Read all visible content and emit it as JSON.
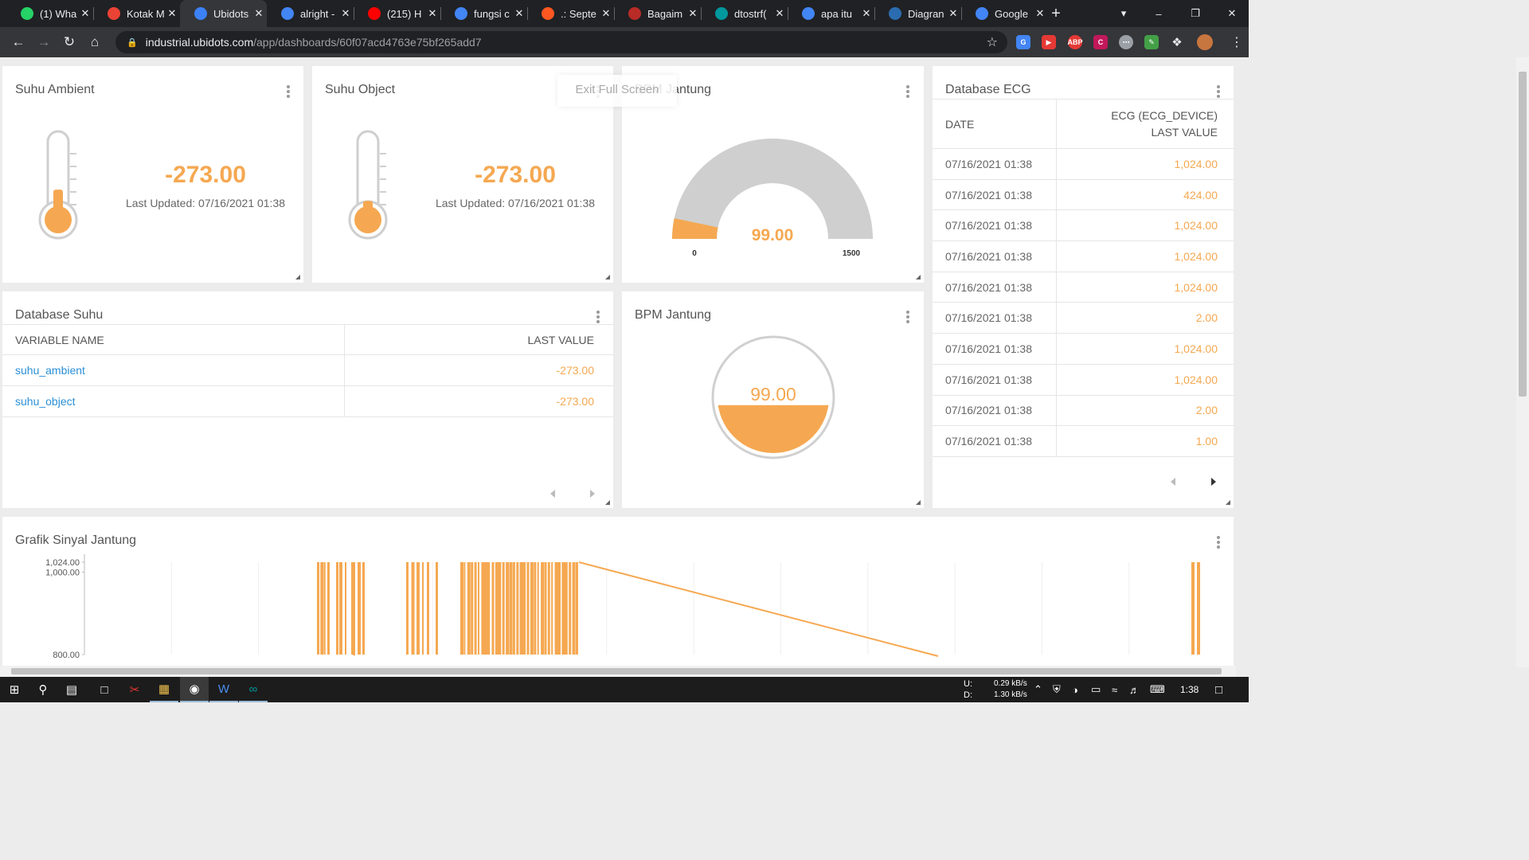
{
  "browser": {
    "tabs": [
      {
        "title": "(1) Wha",
        "icon": "whatsapp-icon",
        "color": "#25d366"
      },
      {
        "title": "Kotak M",
        "icon": "gmail-icon",
        "color": "#ea4335"
      },
      {
        "title": "Ubidots",
        "icon": "ubidots-icon",
        "color": "#3c82f6",
        "active": true
      },
      {
        "title": "alright -",
        "icon": "google-icon",
        "color": "#4285f4"
      },
      {
        "title": "(215) H",
        "icon": "youtube-icon",
        "color": "#ff0000"
      },
      {
        "title": "fungsi c",
        "icon": "google-icon",
        "color": "#4285f4"
      },
      {
        "title": ".: Septe",
        "icon": "blogger-icon",
        "color": "#ff5722"
      },
      {
        "title": "Bagaim",
        "icon": "quora-icon",
        "color": "#b92b27"
      },
      {
        "title": "dtostrf(",
        "icon": "arduino-icon",
        "color": "#00979d"
      },
      {
        "title": "apa itu",
        "icon": "google-icon",
        "color": "#4285f4"
      },
      {
        "title": "Diagran",
        "icon": "diagram-icon",
        "color": "#2b6cb0"
      },
      {
        "title": "Google",
        "icon": "translate-icon",
        "color": "#4285f4"
      }
    ],
    "url_host": "industrial.ubidots.com",
    "url_path": "/app/dashboards/60f07acd4763e75bf265add7"
  },
  "fullscreen_tip": "Exit Full Screen",
  "widgets": {
    "suhu_ambient": {
      "title": "Suhu Ambient",
      "value": "-273.00",
      "updated": "Last Updated: 07/16/2021 01:38",
      "level": 0.35
    },
    "suhu_object": {
      "title": "Suhu Object",
      "value": "-273.00",
      "updated": "Last Updated: 07/16/2021 01:38",
      "level": 0.2
    },
    "bpm_gauge": {
      "title": "BPM Jantung",
      "value": "99.00",
      "min": "0",
      "max": "1500",
      "fraction": 0.066
    },
    "bpm_tank": {
      "title": "BPM Jantung",
      "value": "99.00",
      "level": 0.43
    },
    "database_suhu": {
      "title": "Database Suhu",
      "headers": [
        "VARIABLE NAME",
        "LAST VALUE"
      ],
      "rows": [
        {
          "name": "suhu_ambient",
          "value": "-273.00"
        },
        {
          "name": "suhu_object",
          "value": "-273.00"
        }
      ]
    },
    "database_ecg": {
      "title": "Database ECG",
      "headers": [
        "DATE",
        "ECG (ECG_DEVICE) LAST VALUE"
      ],
      "rows": [
        {
          "date": "07/16/2021 01:38",
          "value": "1,024.00"
        },
        {
          "date": "07/16/2021 01:38",
          "value": "424.00"
        },
        {
          "date": "07/16/2021 01:38",
          "value": "1,024.00"
        },
        {
          "date": "07/16/2021 01:38",
          "value": "1,024.00"
        },
        {
          "date": "07/16/2021 01:38",
          "value": "1,024.00"
        },
        {
          "date": "07/16/2021 01:38",
          "value": "2.00"
        },
        {
          "date": "07/16/2021 01:38",
          "value": "1,024.00"
        },
        {
          "date": "07/16/2021 01:38",
          "value": "1,024.00"
        },
        {
          "date": "07/16/2021 01:38",
          "value": "2.00"
        },
        {
          "date": "07/16/2021 01:38",
          "value": "1.00"
        }
      ]
    },
    "grafik": {
      "title": "Grafik Sinyal Jantung"
    }
  },
  "chart_data": {
    "type": "line",
    "title": "Grafik Sinyal Jantung",
    "ytick_labels": [
      "1,024.00",
      "1,000.00",
      "800.00"
    ],
    "yticks": [
      1024,
      1000,
      800
    ],
    "ylim": [
      800,
      1024
    ],
    "color": "#f5a851",
    "grid": true
  },
  "taskbar": {
    "upload_label": "U:",
    "download_label": "D:",
    "upload_speed": "0.29 kB/s",
    "download_speed": "1.30 kB/s",
    "clock": "1:38"
  }
}
